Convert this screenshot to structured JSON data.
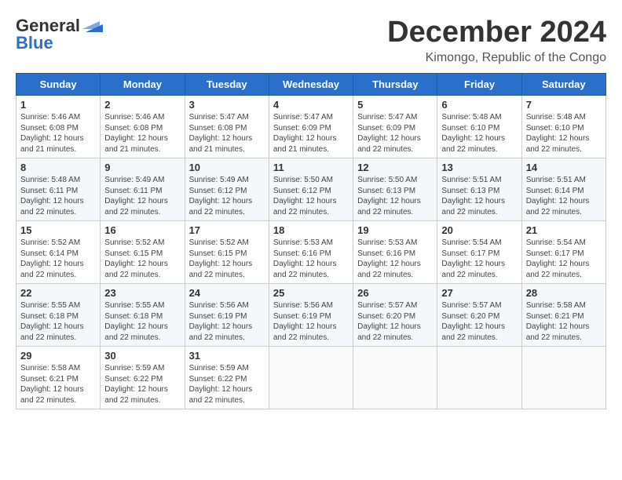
{
  "logo": {
    "general": "General",
    "blue": "Blue",
    "tagline": ""
  },
  "title": "December 2024",
  "location": "Kimongo, Republic of the Congo",
  "days_of_week": [
    "Sunday",
    "Monday",
    "Tuesday",
    "Wednesday",
    "Thursday",
    "Friday",
    "Saturday"
  ],
  "weeks": [
    [
      {
        "day": "1",
        "info": "Sunrise: 5:46 AM\nSunset: 6:08 PM\nDaylight: 12 hours\nand 21 minutes."
      },
      {
        "day": "2",
        "info": "Sunrise: 5:46 AM\nSunset: 6:08 PM\nDaylight: 12 hours\nand 21 minutes."
      },
      {
        "day": "3",
        "info": "Sunrise: 5:47 AM\nSunset: 6:08 PM\nDaylight: 12 hours\nand 21 minutes."
      },
      {
        "day": "4",
        "info": "Sunrise: 5:47 AM\nSunset: 6:09 PM\nDaylight: 12 hours\nand 21 minutes."
      },
      {
        "day": "5",
        "info": "Sunrise: 5:47 AM\nSunset: 6:09 PM\nDaylight: 12 hours\nand 22 minutes."
      },
      {
        "day": "6",
        "info": "Sunrise: 5:48 AM\nSunset: 6:10 PM\nDaylight: 12 hours\nand 22 minutes."
      },
      {
        "day": "7",
        "info": "Sunrise: 5:48 AM\nSunset: 6:10 PM\nDaylight: 12 hours\nand 22 minutes."
      }
    ],
    [
      {
        "day": "8",
        "info": "Sunrise: 5:48 AM\nSunset: 6:11 PM\nDaylight: 12 hours\nand 22 minutes."
      },
      {
        "day": "9",
        "info": "Sunrise: 5:49 AM\nSunset: 6:11 PM\nDaylight: 12 hours\nand 22 minutes."
      },
      {
        "day": "10",
        "info": "Sunrise: 5:49 AM\nSunset: 6:12 PM\nDaylight: 12 hours\nand 22 minutes."
      },
      {
        "day": "11",
        "info": "Sunrise: 5:50 AM\nSunset: 6:12 PM\nDaylight: 12 hours\nand 22 minutes."
      },
      {
        "day": "12",
        "info": "Sunrise: 5:50 AM\nSunset: 6:13 PM\nDaylight: 12 hours\nand 22 minutes."
      },
      {
        "day": "13",
        "info": "Sunrise: 5:51 AM\nSunset: 6:13 PM\nDaylight: 12 hours\nand 22 minutes."
      },
      {
        "day": "14",
        "info": "Sunrise: 5:51 AM\nSunset: 6:14 PM\nDaylight: 12 hours\nand 22 minutes."
      }
    ],
    [
      {
        "day": "15",
        "info": "Sunrise: 5:52 AM\nSunset: 6:14 PM\nDaylight: 12 hours\nand 22 minutes."
      },
      {
        "day": "16",
        "info": "Sunrise: 5:52 AM\nSunset: 6:15 PM\nDaylight: 12 hours\nand 22 minutes."
      },
      {
        "day": "17",
        "info": "Sunrise: 5:52 AM\nSunset: 6:15 PM\nDaylight: 12 hours\nand 22 minutes."
      },
      {
        "day": "18",
        "info": "Sunrise: 5:53 AM\nSunset: 6:16 PM\nDaylight: 12 hours\nand 22 minutes."
      },
      {
        "day": "19",
        "info": "Sunrise: 5:53 AM\nSunset: 6:16 PM\nDaylight: 12 hours\nand 22 minutes."
      },
      {
        "day": "20",
        "info": "Sunrise: 5:54 AM\nSunset: 6:17 PM\nDaylight: 12 hours\nand 22 minutes."
      },
      {
        "day": "21",
        "info": "Sunrise: 5:54 AM\nSunset: 6:17 PM\nDaylight: 12 hours\nand 22 minutes."
      }
    ],
    [
      {
        "day": "22",
        "info": "Sunrise: 5:55 AM\nSunset: 6:18 PM\nDaylight: 12 hours\nand 22 minutes."
      },
      {
        "day": "23",
        "info": "Sunrise: 5:55 AM\nSunset: 6:18 PM\nDaylight: 12 hours\nand 22 minutes."
      },
      {
        "day": "24",
        "info": "Sunrise: 5:56 AM\nSunset: 6:19 PM\nDaylight: 12 hours\nand 22 minutes."
      },
      {
        "day": "25",
        "info": "Sunrise: 5:56 AM\nSunset: 6:19 PM\nDaylight: 12 hours\nand 22 minutes."
      },
      {
        "day": "26",
        "info": "Sunrise: 5:57 AM\nSunset: 6:20 PM\nDaylight: 12 hours\nand 22 minutes."
      },
      {
        "day": "27",
        "info": "Sunrise: 5:57 AM\nSunset: 6:20 PM\nDaylight: 12 hours\nand 22 minutes."
      },
      {
        "day": "28",
        "info": "Sunrise: 5:58 AM\nSunset: 6:21 PM\nDaylight: 12 hours\nand 22 minutes."
      }
    ],
    [
      {
        "day": "29",
        "info": "Sunrise: 5:58 AM\nSunset: 6:21 PM\nDaylight: 12 hours\nand 22 minutes."
      },
      {
        "day": "30",
        "info": "Sunrise: 5:59 AM\nSunset: 6:22 PM\nDaylight: 12 hours\nand 22 minutes."
      },
      {
        "day": "31",
        "info": "Sunrise: 5:59 AM\nSunset: 6:22 PM\nDaylight: 12 hours\nand 22 minutes."
      },
      {
        "day": "",
        "info": ""
      },
      {
        "day": "",
        "info": ""
      },
      {
        "day": "",
        "info": ""
      },
      {
        "day": "",
        "info": ""
      }
    ]
  ]
}
